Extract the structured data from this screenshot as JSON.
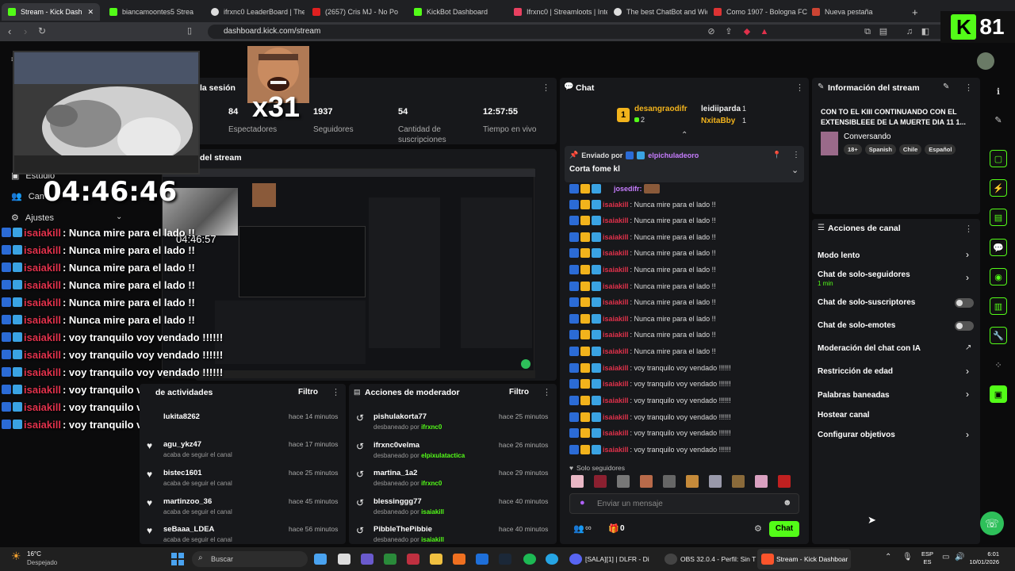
{
  "browser": {
    "tabs": [
      {
        "label": "Stream - Kick Dash",
        "active": true
      },
      {
        "label": "biancamoontes5 Strea"
      },
      {
        "label": "ifrxnc0 LeaderBoard | The"
      },
      {
        "label": "(2657) Cris MJ - No Po"
      },
      {
        "label": "KickBot Dashboard"
      },
      {
        "label": "Ifrxnc0 | Streamloots | Inte"
      },
      {
        "label": "The best ChatBot and Wid"
      },
      {
        "label": "Como 1907 - Bologna FC"
      },
      {
        "label": "Nueva pestaña"
      }
    ],
    "url": "dashboard.kick.com/stream"
  },
  "counter_overlay": {
    "value": "81"
  },
  "dashboard": {
    "session_title": "la sesión",
    "stats": [
      {
        "value": "84",
        "label": "Espectadores"
      },
      {
        "value": "1937",
        "label": "Seguidores"
      },
      {
        "value": "54",
        "label": "Cantidad de suscripciones"
      },
      {
        "value": "12:57:55",
        "label": "Tiempo en vivo"
      }
    ],
    "stream_panel_title": "del stream",
    "sidebar": {
      "estudio": "Estudio",
      "can": "Can",
      "ajustes": "Ajustes"
    }
  },
  "overlay": {
    "multiplier": "x31",
    "clock": "04:46:46",
    "inner_clock": "04:46:57",
    "chat": [
      {
        "user": "isaiakill",
        "msg": ": Nunca mire para el lado !!"
      },
      {
        "user": "isaiakill",
        "msg": ": Nunca mire para el lado !!"
      },
      {
        "user": "isaiakill",
        "msg": ": Nunca mire para el lado !!"
      },
      {
        "user": "isaiakill",
        "msg": ": Nunca mire para el lado !!"
      },
      {
        "user": "isaiakill",
        "msg": ": Nunca mire para el lado !!"
      },
      {
        "user": "isaiakill",
        "msg": ": Nunca mire para el lado !!"
      },
      {
        "user": "isaiakill",
        "msg": ": voy tranquilo voy vendado !!!!!!"
      },
      {
        "user": "isaiakill",
        "msg": ": voy tranquilo voy vendado !!!!!!"
      },
      {
        "user": "isaiakill",
        "msg": ": voy tranquilo voy vendado !!!!!!"
      },
      {
        "user": "isaiakill",
        "msg": ": voy tranquilo voy vendado !!!!!!"
      },
      {
        "user": "isaiakill",
        "msg": ": voy tranquilo voy vendado !!!!!!"
      },
      {
        "user": "isaiakill",
        "msg": ": voy tranquilo voy vendado !!!!!!"
      }
    ]
  },
  "activity": {
    "title": "de actividades",
    "filter": "Filtro",
    "items": [
      {
        "name": "lukita8262",
        "sub": "",
        "time": "hace 14 minutos"
      },
      {
        "name": "agu_ykz47",
        "sub": "acaba de seguir el canal",
        "time": "hace 17 minutos"
      },
      {
        "name": "bistec1601",
        "sub": "acaba de seguir el canal",
        "time": "hace 25 minutos"
      },
      {
        "name": "martinzoo_36",
        "sub": "acaba de seguir el canal",
        "time": "hace 45 minutos"
      },
      {
        "name": "seBaaa_LDEA",
        "sub": "acaba de seguir el canal",
        "time": "hace 56 minutos"
      }
    ]
  },
  "moderator": {
    "title": "Acciones de moderador",
    "filter": "Filtro",
    "items": [
      {
        "name": "pishulakorta77",
        "sub": "desbaneado por",
        "by": "ifrxnc0",
        "time": "hace 25 minutos"
      },
      {
        "name": "ifrxnc0velma",
        "sub": "desbaneado por",
        "by": "elpixulatactica",
        "time": "hace 26 minutos"
      },
      {
        "name": "martina_1a2",
        "sub": "desbaneado por",
        "by": "ifrxnc0",
        "time": "hace 29 minutos"
      },
      {
        "name": "blessinggg77",
        "sub": "desbaneado por",
        "by": "isaiakill",
        "time": "hace 40 minutos"
      },
      {
        "name": "PibbleThePibbie",
        "sub": "desbaneado por",
        "by": "isaiakill",
        "time": "hace 40 minutos"
      }
    ]
  },
  "chat": {
    "title": "Chat",
    "top_gifters": [
      {
        "name": "desangraodifr",
        "count": "2"
      },
      {
        "name": "leidiiparda",
        "count": "1"
      },
      {
        "name": "NxitaBby",
        "count": "1"
      }
    ],
    "rank": "1",
    "pinned_by_label": "Enviado por",
    "pinned_user": "elpichuladeoro",
    "pinned_msg": "Corta fome kl",
    "first_line_user": "josedifr:",
    "lines": [
      {
        "user": "isaiakill",
        "msg": ": Nunca mire para el lado !!"
      },
      {
        "user": "isaiakill",
        "msg": ": Nunca mire para el lado !!"
      },
      {
        "user": "isaiakill",
        "msg": ": Nunca mire para el lado !!"
      },
      {
        "user": "isaiakill",
        "msg": ": Nunca mire para el lado !!"
      },
      {
        "user": "isaiakill",
        "msg": ": Nunca mire para el lado !!"
      },
      {
        "user": "isaiakill",
        "msg": ": Nunca mire para el lado !!"
      },
      {
        "user": "isaiakill",
        "msg": ": Nunca mire para el lado !!"
      },
      {
        "user": "isaiakill",
        "msg": ": Nunca mire para el lado !!"
      },
      {
        "user": "isaiakill",
        "msg": ": Nunca mire para el lado !!"
      },
      {
        "user": "isaiakill",
        "msg": ": Nunca mire para el lado !!"
      },
      {
        "user": "isaiakill",
        "msg": ": voy tranquilo voy vendado !!!!!!"
      },
      {
        "user": "isaiakill",
        "msg": ": voy tranquilo voy vendado !!!!!!"
      },
      {
        "user": "isaiakill",
        "msg": ": voy tranquilo voy vendado !!!!!!"
      },
      {
        "user": "isaiakill",
        "msg": ": voy tranquilo voy vendado !!!!!!"
      },
      {
        "user": "isaiakill",
        "msg": ": voy tranquilo voy vendado !!!!!!"
      },
      {
        "user": "isaiakill",
        "msg": ": voy tranquilo voy vendado !!!!!!"
      }
    ],
    "followers_only": "Solo seguidores",
    "input_placeholder": "Enviar un mensaje",
    "count": "0",
    "send_label": "Chat"
  },
  "stream_info": {
    "title": "Información del stream",
    "stream_title": "CON TO EL KIII CONTINUANDO CON EL EXTENSIBLEEE DE LA MUERTE DIA 11 1...",
    "category": "Conversando",
    "tags": [
      "18+",
      "Spanish",
      "Chile",
      "Español"
    ]
  },
  "channel_actions": {
    "title": "Acciones de canal",
    "items": [
      {
        "label": "Modo lento"
      },
      {
        "label": "Chat de solo-seguidores",
        "sub": "1 min"
      },
      {
        "label": "Chat de solo-suscriptores"
      },
      {
        "label": "Chat de solo-emotes"
      },
      {
        "label": "Moderación del chat con IA"
      },
      {
        "label": "Restricción de edad"
      },
      {
        "label": "Palabras baneadas"
      },
      {
        "label": "Hostear canal"
      },
      {
        "label": "Configurar objetivos"
      }
    ]
  },
  "taskbar": {
    "weather_temp": "16°C",
    "weather_desc": "Despejado",
    "search": "Buscar",
    "app1": "[SALA][1] | DLFR - Di",
    "app2": "OBS 32.0.4 - Perfil: Sin T",
    "app3": "Stream - Kick Dashboar",
    "lang": "ESP",
    "lang2": "ES",
    "time": "6:01",
    "date": "10/01/2026"
  },
  "colors": {
    "kick_green": "#53fc18",
    "panel": "#17181b",
    "chat_name_red": "#e0314b"
  }
}
